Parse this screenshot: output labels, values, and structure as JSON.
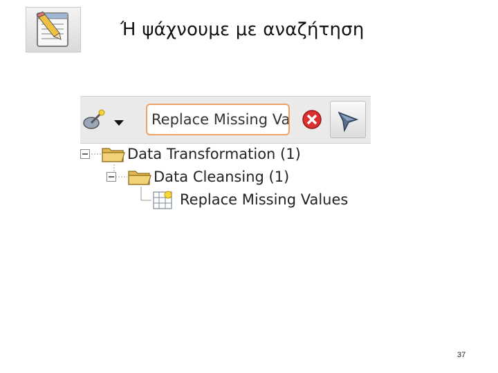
{
  "slide": {
    "title": "Ή ψάχνουμε με αναζήτηση",
    "page_number": "37"
  },
  "toolbar": {
    "search": {
      "value": "Replace Missing Va"
    }
  },
  "tree": {
    "nodes": [
      {
        "label": "Data Transformation (1)"
      },
      {
        "label": "Data Cleansing (1)"
      },
      {
        "label": "Replace Missing Values"
      }
    ]
  },
  "icons": {
    "notepad": "notepad-pencil-icon",
    "wand": "magic-wand-icon",
    "dropdown": "triangle-down",
    "clear": "red-x-circle",
    "filter": "filter-funnel",
    "folder": "folder-open",
    "operator": "table-grid-with-star"
  },
  "colors": {
    "search_border": "#f0a060",
    "clear_button": "#d93030",
    "folder": "#e8c060"
  }
}
